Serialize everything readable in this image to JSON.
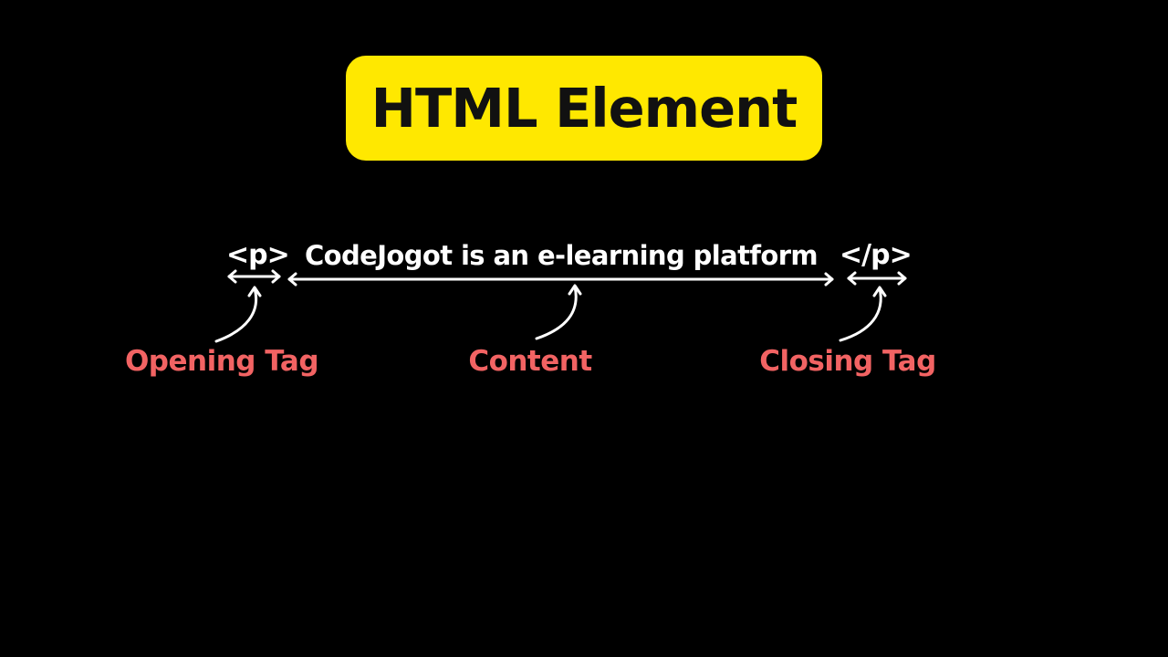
{
  "title": "HTML Element",
  "code": {
    "opening_tag": "<p>",
    "content": "CodeJogot is an e-learning platform",
    "closing_tag": "</p>"
  },
  "labels": {
    "opening": "Opening Tag",
    "content": "Content",
    "closing": "Closing Tag"
  },
  "colors": {
    "background": "#000000",
    "title_badge": "#ffe800",
    "title_text": "#111111",
    "code_text": "#ffffff",
    "label_text": "#f26363",
    "arrows": "#ffffff"
  }
}
